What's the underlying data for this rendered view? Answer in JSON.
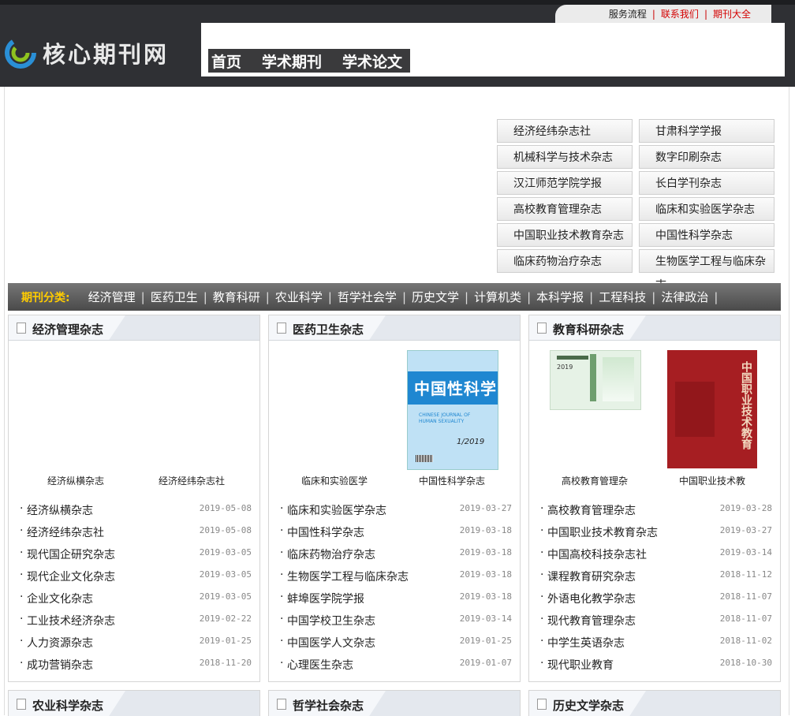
{
  "header": {
    "logo_text": "核心期刊网",
    "top_links": [
      "服务流程",
      "联系我们",
      "期刊大全"
    ],
    "nav": [
      "首页",
      "学术期刊",
      "学术论文"
    ]
  },
  "journal_grid": [
    "经济经纬杂志社",
    "甘肃科学学报",
    "机械科学与技术杂志",
    "数字印刷杂志",
    "汉江师范学院学报",
    "长白学刊杂志",
    "高校教育管理杂志",
    "临床和实验医学杂志",
    "中国职业技术教育杂志",
    "中国性科学杂志",
    "临床药物治疗杂志",
    "生物医学工程与临床杂志"
  ],
  "category_bar": {
    "label": "期刊分类:",
    "items": [
      "经济管理",
      "医药卫生",
      "教育科研",
      "农业科学",
      "哲学社会学",
      "历史文学",
      "计算机类",
      "本科学报",
      "工程科技",
      "法律政治"
    ]
  },
  "panels": [
    {
      "title": "经济管理杂志",
      "captions": [
        "经济纵横杂志",
        "经济经纬杂志社"
      ],
      "items": [
        {
          "title": "经济纵横杂志",
          "date": "2019-05-08"
        },
        {
          "title": "经济经纬杂志社",
          "date": "2019-05-08"
        },
        {
          "title": "现代国企研究杂志",
          "date": "2019-03-05"
        },
        {
          "title": "现代企业文化杂志",
          "date": "2019-03-05"
        },
        {
          "title": "企业文化杂志",
          "date": "2019-03-05"
        },
        {
          "title": "工业技术经济杂志",
          "date": "2019-02-22"
        },
        {
          "title": "人力资源杂志",
          "date": "2019-01-25"
        },
        {
          "title": "成功营销杂志",
          "date": "2018-11-20"
        }
      ]
    },
    {
      "title": "医药卫生杂志",
      "captions": [
        "临床和实验医学",
        "中国性科学杂志"
      ],
      "cover_text": {
        "title": "中国性科学",
        "en": "CHINESE JOURNAL OF HUMAN SEXUALITY",
        "issue": "1/2019"
      },
      "items": [
        {
          "title": "临床和实验医学杂志",
          "date": "2019-03-27"
        },
        {
          "title": "中国性科学杂志",
          "date": "2019-03-18"
        },
        {
          "title": "临床药物治疗杂志",
          "date": "2019-03-18"
        },
        {
          "title": "生物医学工程与临床杂志",
          "date": "2019-03-18"
        },
        {
          "title": "蚌埠医学院学报",
          "date": "2019-03-18"
        },
        {
          "title": "中国学校卫生杂志",
          "date": "2019-03-14"
        },
        {
          "title": "中国医学人文杂志",
          "date": "2019-01-25"
        },
        {
          "title": "心理医生杂志",
          "date": "2019-01-07"
        }
      ]
    },
    {
      "title": "教育科研杂志",
      "captions": [
        "高校教育管理杂",
        "中国职业技术教"
      ],
      "cover_text": {
        "left_year": "2019",
        "right_title": "中国职业技术教育"
      },
      "items": [
        {
          "title": "高校教育管理杂志",
          "date": "2019-03-28"
        },
        {
          "title": "中国职业技术教育杂志",
          "date": "2019-03-27"
        },
        {
          "title": "中国高校科技杂志社",
          "date": "2019-03-14"
        },
        {
          "title": "课程教育研究杂志",
          "date": "2018-11-12"
        },
        {
          "title": "外语电化教学杂志",
          "date": "2018-11-07"
        },
        {
          "title": "现代教育管理杂志",
          "date": "2018-11-07"
        },
        {
          "title": "中学生英语杂志",
          "date": "2018-11-02"
        },
        {
          "title": "现代职业教育",
          "date": "2018-10-30"
        }
      ]
    }
  ],
  "bottom_panels": [
    "农业科学杂志",
    "哲学社会杂志",
    "历史文学杂志"
  ],
  "colors": {
    "accent_red": "#d40000",
    "category_label": "#ffcc00",
    "cover_blue": "#1f87d1",
    "cover_red": "#a61e22"
  }
}
